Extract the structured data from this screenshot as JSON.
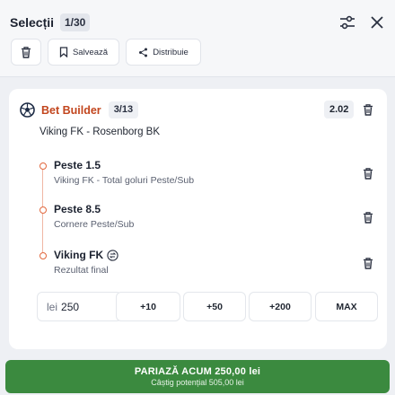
{
  "header": {
    "title": "Selecții",
    "count": "1/30",
    "actions": {
      "delete_icon": "trash-icon",
      "save_label": "Salvează",
      "save_icon": "bookmark-icon",
      "share_label": "Distribuie",
      "share_icon": "share-icon"
    },
    "right_icons": [
      "sliders-icon",
      "close-icon"
    ]
  },
  "bet_builder": {
    "icon": "soccer-ball-icon",
    "title": "Bet Builder",
    "count": "3/13",
    "odds": "2.02",
    "match": "Viking FK - Rosenborg BK",
    "selections": [
      {
        "name": "Peste 1.5",
        "market": "Viking FK - Total goluri Peste/Sub",
        "badge_icon": ""
      },
      {
        "name": "Peste 8.5",
        "market": "Cornere Peste/Sub",
        "badge_icon": ""
      },
      {
        "name": "Viking FK",
        "market": "Rezultat final",
        "badge_icon": "two-way-arrows-icon"
      }
    ]
  },
  "stake": {
    "currency": "lei",
    "value": "250",
    "quick_amounts": [
      "+10",
      "+50",
      "+200",
      "MAX"
    ]
  },
  "bet_button": {
    "label": "PARIAZĂ ACUM  250,00 lei",
    "potential": "Câștig potențial 505,00 lei",
    "color": "#3b8a3f"
  },
  "colors": {
    "accent": "#c2461e",
    "timeline": "#e2683e"
  }
}
